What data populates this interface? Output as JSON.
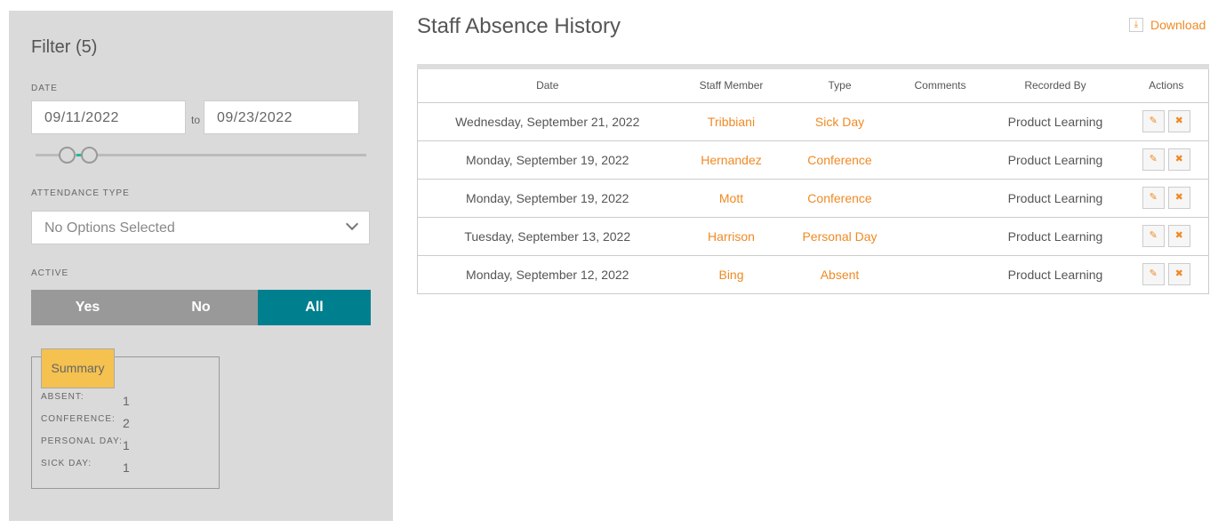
{
  "filter": {
    "title": "Filter (5)",
    "date_label": "DATE",
    "date_from": "09/11/2022",
    "date_to": "09/23/2022",
    "to_label": "to",
    "attendance_label": "ATTENDANCE TYPE",
    "attendance_value": "No Options Selected",
    "active_label": "ACTIVE",
    "active_options": [
      "Yes",
      "No",
      "All"
    ],
    "active_selected": "All",
    "accent": "#00808f"
  },
  "summary": {
    "title": "Summary",
    "items": [
      {
        "label": "ABSENT:",
        "value": "1"
      },
      {
        "label": "CONFERENCE:",
        "value": "2"
      },
      {
        "label": "PERSONAL DAY:",
        "value": "1"
      },
      {
        "label": "SICK DAY:",
        "value": "1"
      }
    ]
  },
  "page": {
    "title": "Staff Absence History",
    "download": "Download"
  },
  "table": {
    "headers": [
      "Date",
      "Staff Member",
      "Type",
      "Comments",
      "Recorded By",
      "Actions"
    ],
    "rows": [
      {
        "date": "Wednesday, September 21, 2022",
        "staff": "Tribbiani",
        "type": "Sick Day",
        "comments": "",
        "recorded_by": "Product Learning"
      },
      {
        "date": "Monday, September 19, 2022",
        "staff": "Hernandez",
        "type": "Conference",
        "comments": "",
        "recorded_by": "Product Learning"
      },
      {
        "date": "Monday, September 19, 2022",
        "staff": "Mott",
        "type": "Conference",
        "comments": "",
        "recorded_by": "Product Learning"
      },
      {
        "date": "Tuesday, September 13, 2022",
        "staff": "Harrison",
        "type": "Personal Day",
        "comments": "",
        "recorded_by": "Product Learning"
      },
      {
        "date": "Monday, September 12, 2022",
        "staff": "Bing",
        "type": "Absent",
        "comments": "",
        "recorded_by": "Product Learning"
      }
    ]
  }
}
